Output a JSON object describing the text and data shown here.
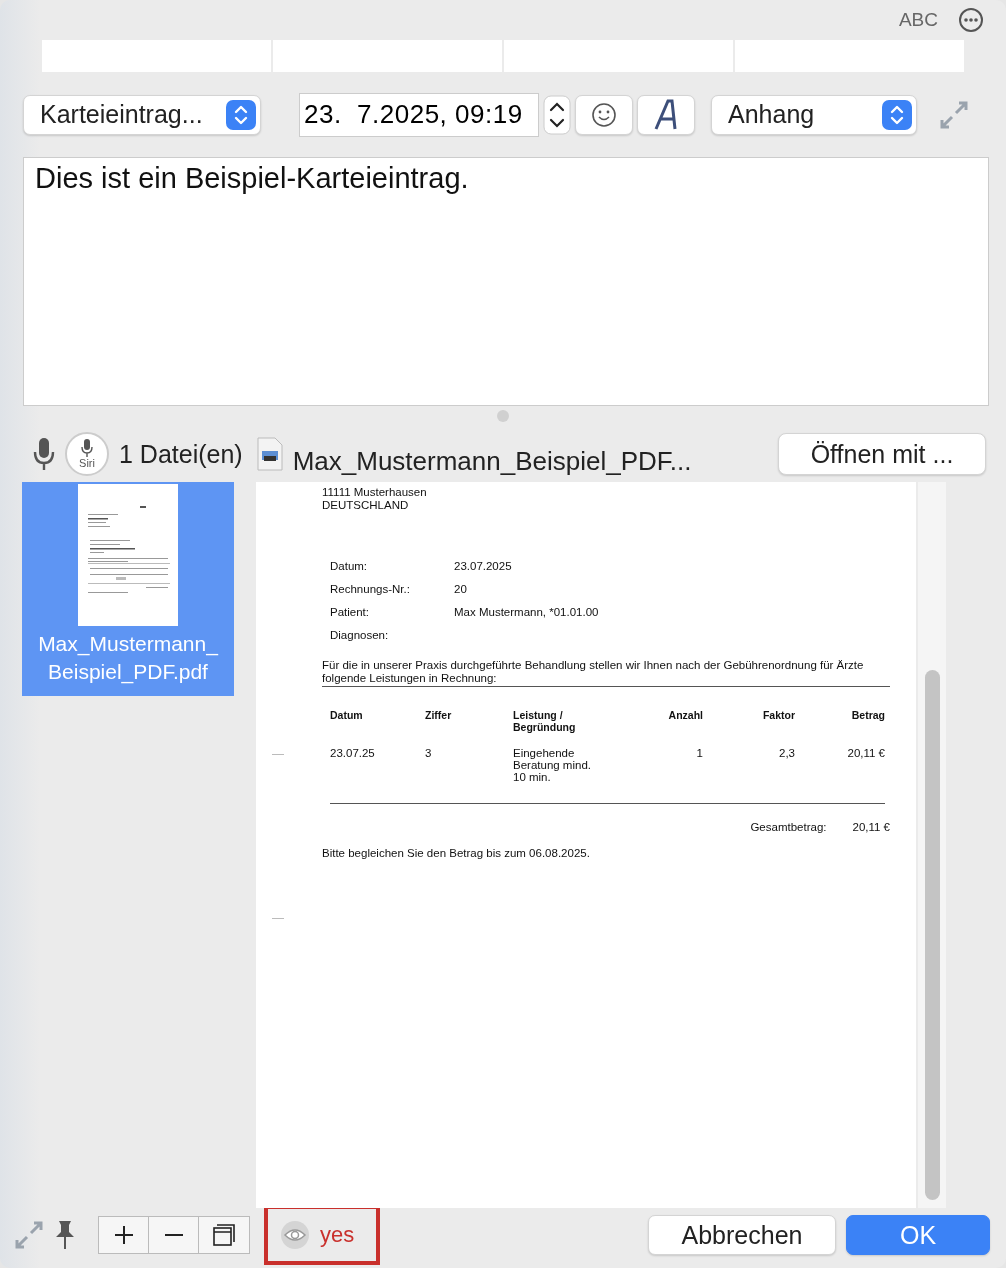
{
  "top_bar": {
    "spelling_label": "ABC"
  },
  "entry_type": {
    "value": "Karteieintrag..."
  },
  "date_field": {
    "value": "23.  7.2025, 09:19"
  },
  "attachment_select": {
    "value": "Anhang"
  },
  "note": {
    "text": "Dies ist ein Beispiel-Karteieintrag."
  },
  "siri_label": "Siri",
  "file_count": "1 Datei(en)",
  "file_name": "Max_Mustermann_Beispiel_PDF...",
  "open_with_button": "Öffnen mit ...",
  "thumbnails": [
    {
      "name": "Max_Mustermann_Beispiel_PDF.pdf",
      "selected": true
    }
  ],
  "document": {
    "address": [
      "11111 Musterhausen",
      "DEUTSCHLAND"
    ],
    "fields": [
      {
        "label": "Datum:",
        "value": "23.07.2025"
      },
      {
        "label": "Rechnungs-Nr.:",
        "value": "20"
      },
      {
        "label": "Patient:",
        "value": "Max Mustermann, *01.01.00"
      },
      {
        "label": "Diagnosen:"
      }
    ],
    "intro": "Für die in unserer Praxis durchgeführte Behandlung stellen wir Ihnen nach der Gebührenordnung für Ärzte folgende Leistungen in Rechnung:",
    "table": {
      "columns": [
        "Datum",
        "Ziffer",
        "Leistung / Begründung",
        "Anzahl",
        "Faktor",
        "Betrag"
      ],
      "rows": [
        [
          "23.07.25",
          "3",
          "Eingehende Beratung mind. 10 min.",
          "1",
          "2,3",
          "20,11 €"
        ]
      ]
    },
    "total": {
      "label": "Gesamtbetrag:",
      "value": "20,11 €"
    },
    "footer": "Bitte begleichen Sie den Betrag bis zum 06.08.2025."
  },
  "status": {
    "text": "yes"
  },
  "buttons": [
    {
      "label": "Abbrechen",
      "kind": "cancel"
    },
    {
      "label": "OK",
      "kind": "default"
    }
  ]
}
